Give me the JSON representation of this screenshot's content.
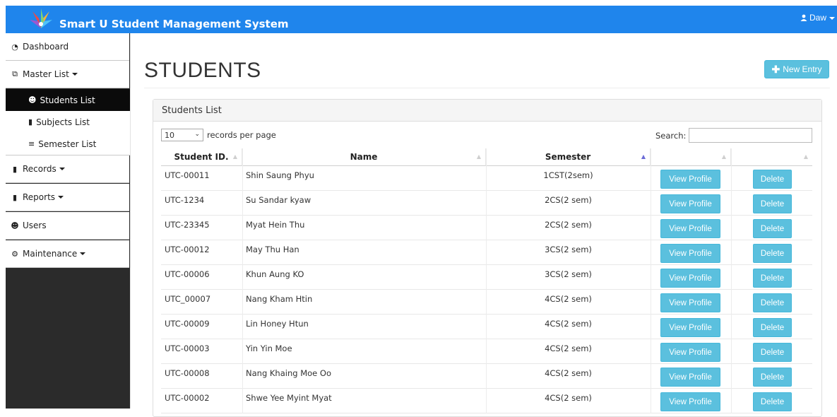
{
  "header": {
    "app_title": "Smart U Student Management System",
    "user_name": "Daw",
    "brand_color": "#1f85ec"
  },
  "sidebar": {
    "items": [
      {
        "label": "Dashboard",
        "icon": "dashboard-icon"
      },
      {
        "label": "Master List",
        "icon": "list-icon"
      },
      {
        "label": "Records",
        "icon": "file-icon"
      },
      {
        "label": "Reports",
        "icon": "file-icon"
      },
      {
        "label": "Users",
        "icon": "users-icon"
      },
      {
        "label": "Maintenance",
        "icon": "cogs-icon"
      }
    ],
    "master_sub": [
      {
        "label": "Students List",
        "icon": "users-icon",
        "active": true
      },
      {
        "label": "Subjects List",
        "icon": "book-icon"
      },
      {
        "label": "Semester List",
        "icon": "bars-icon"
      }
    ]
  },
  "page": {
    "title": "STUDENTS",
    "new_entry_label": "New Entry",
    "panel_title": "Students List",
    "page_length": "10",
    "records_per_page_label": "records per page",
    "search_label": "Search:",
    "search_value": ""
  },
  "table": {
    "columns": [
      "Student ID.",
      "Name",
      "Semester",
      "",
      ""
    ],
    "view_label": "View Profile",
    "delete_label": "Delete",
    "rows": [
      {
        "id": "UTC-00011",
        "name": "Shin Saung Phyu",
        "semester": "1CST(2sem)"
      },
      {
        "id": "UTC-1234",
        "name": "Su Sandar kyaw",
        "semester": "2CS(2 sem)"
      },
      {
        "id": "UTC-23345",
        "name": "Myat Hein Thu",
        "semester": "2CS(2 sem)"
      },
      {
        "id": "UTC-00012",
        "name": "May Thu Han",
        "semester": "3CS(2 sem)"
      },
      {
        "id": "UTC-00006",
        "name": "Khun Aung KO",
        "semester": "3CS(2 sem)"
      },
      {
        "id": "UTC_00007",
        "name": "Nang Kham Htin",
        "semester": "4CS(2 sem)"
      },
      {
        "id": "UTC-00009",
        "name": "Lin Honey Htun",
        "semester": "4CS(2 sem)"
      },
      {
        "id": "UTC-00003",
        "name": "Yin Yin Moe",
        "semester": "4CS(2 sem)"
      },
      {
        "id": "UTC-00008",
        "name": "Nang Khaing Moe Oo",
        "semester": "4CS(2 sem)"
      },
      {
        "id": "UTC-00002",
        "name": "Shwe Yee Myint Myat",
        "semester": "4CS(2 sem)"
      }
    ]
  }
}
